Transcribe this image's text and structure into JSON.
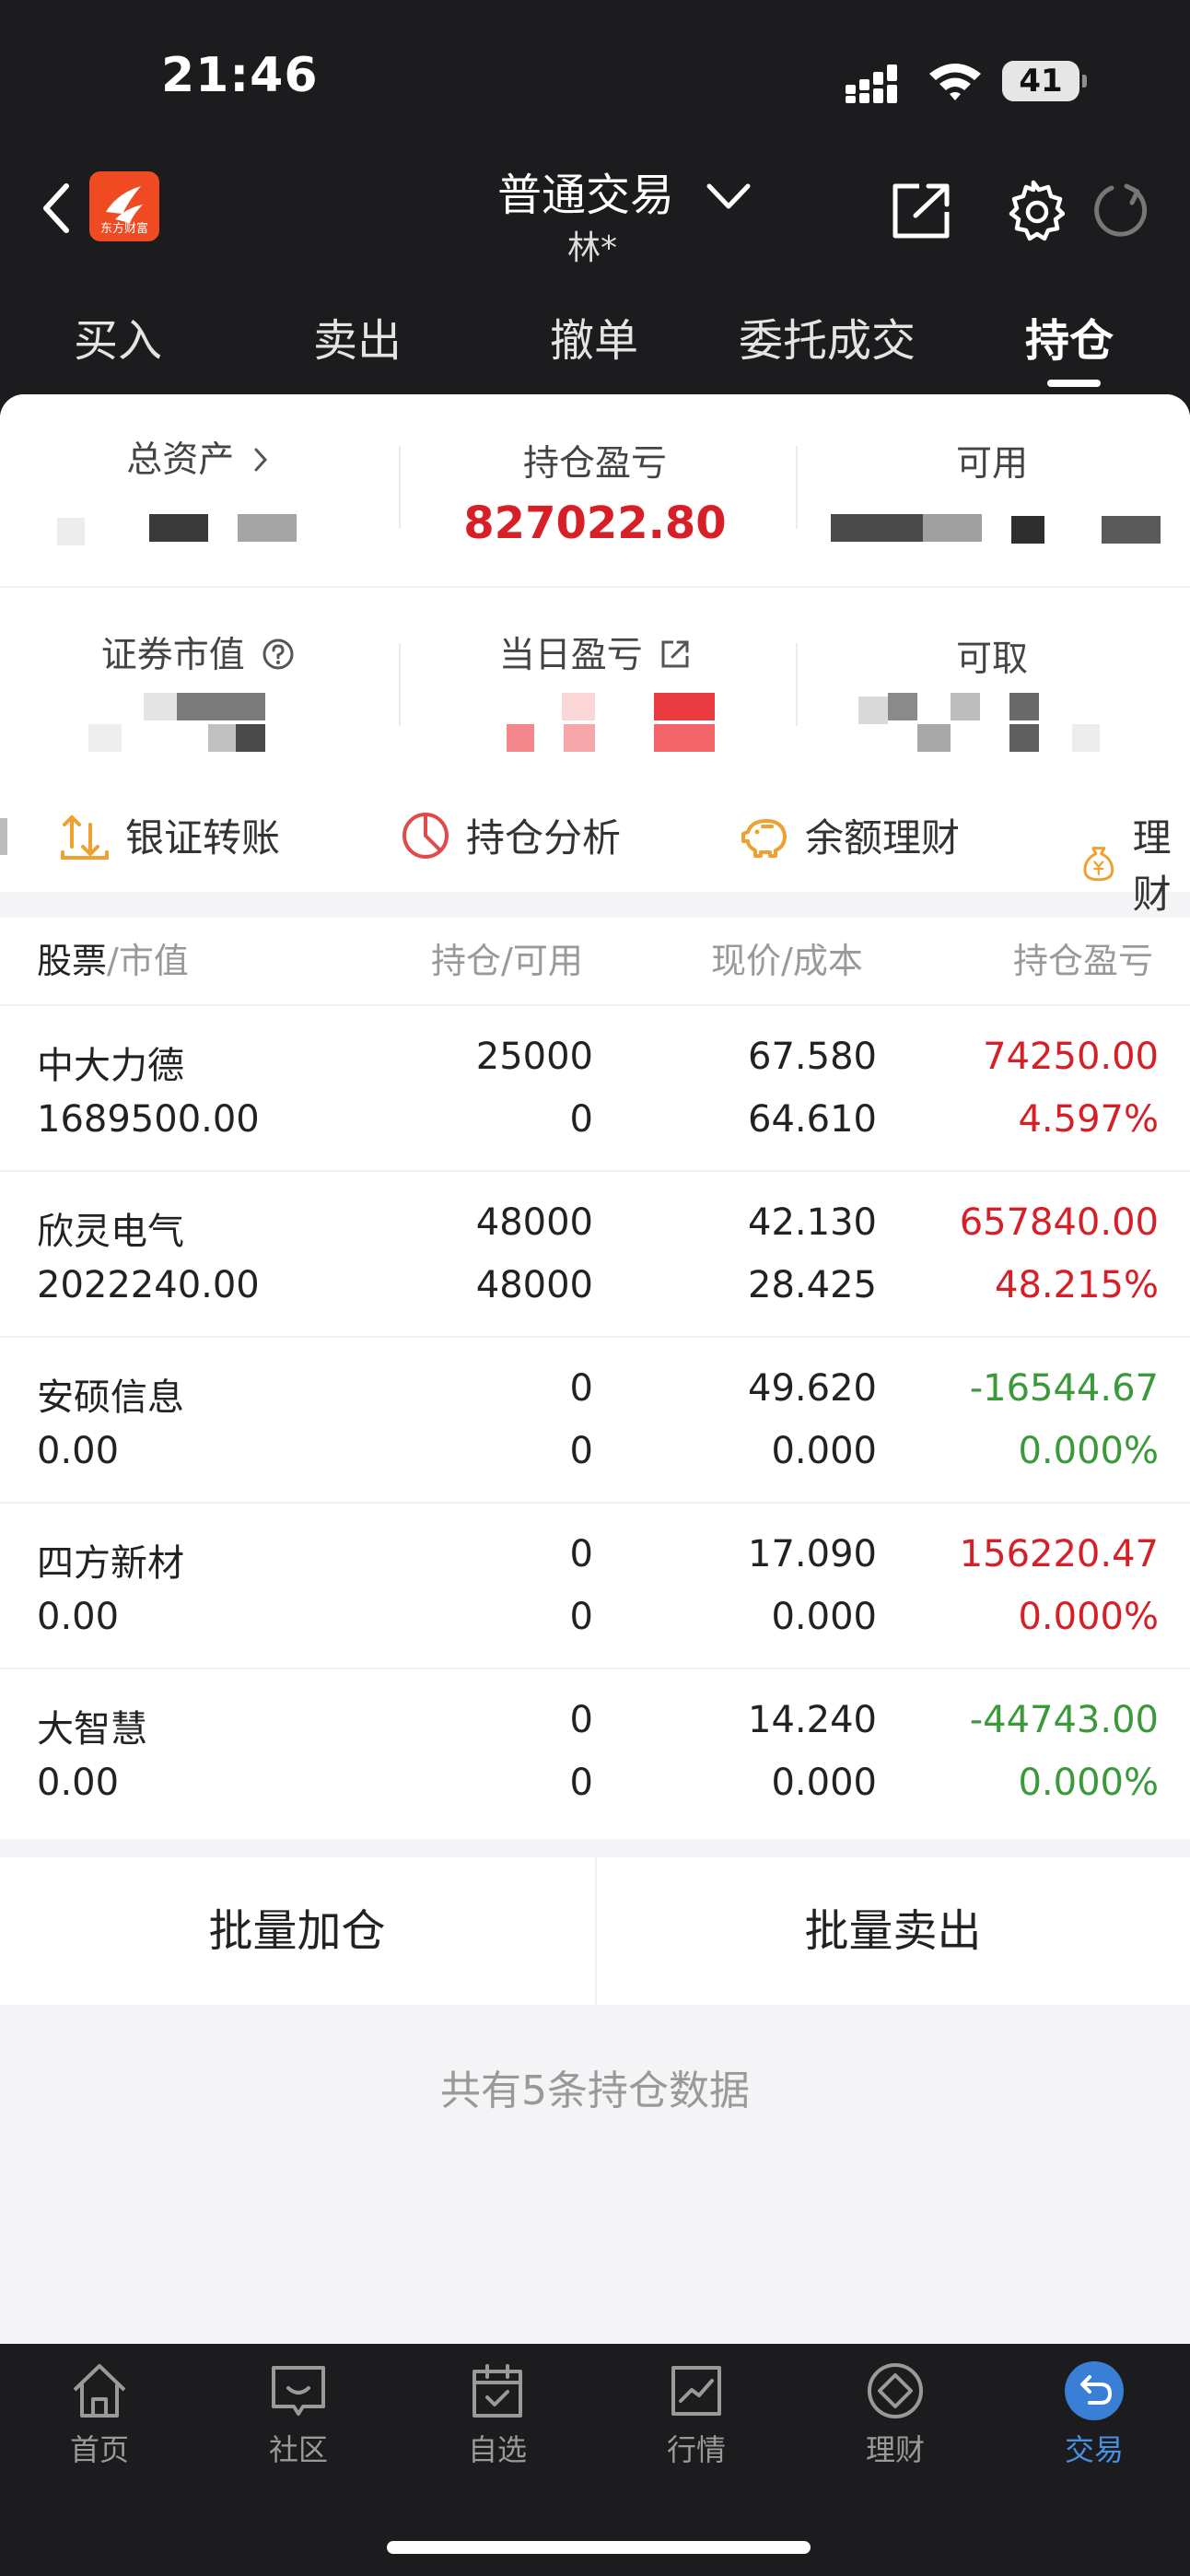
{
  "status": {
    "time": "21:46",
    "battery": "41"
  },
  "header": {
    "logo_text": "东方财富",
    "title": "普通交易",
    "account": "林*"
  },
  "tabs": [
    "买入",
    "卖出",
    "撤单",
    "委托成交",
    "持仓"
  ],
  "summary": {
    "total_assets_label": "总资产",
    "position_pnl_label": "持仓盈亏",
    "position_pnl_value": "827022.80",
    "available_label": "可用",
    "market_value_label": "证券市值",
    "daily_pnl_label": "当日盈亏",
    "withdrawable_label": "可取"
  },
  "quick_links": [
    "银证转账",
    "持仓分析",
    "余额理财",
    "理财"
  ],
  "table": {
    "headers": {
      "stock": "股票",
      "stock_sub": "/市值",
      "position": "持仓",
      "position_sub": "/可用",
      "price": "现价",
      "price_sub": "/成本",
      "pnl": "持仓盈亏"
    },
    "rows": [
      {
        "name": "中大力德",
        "market_value": "1689500.00",
        "position": "25000",
        "available": "0",
        "price": "67.580",
        "cost": "64.610",
        "pnl": "74250.00",
        "pnl_pct": "4.597%",
        "trend": "up"
      },
      {
        "name": "欣灵电气",
        "market_value": "2022240.00",
        "position": "48000",
        "available": "48000",
        "price": "42.130",
        "cost": "28.425",
        "pnl": "657840.00",
        "pnl_pct": "48.215%",
        "trend": "up"
      },
      {
        "name": "安硕信息",
        "market_value": "0.00",
        "position": "0",
        "available": "0",
        "price": "49.620",
        "cost": "0.000",
        "pnl": "-16544.67",
        "pnl_pct": "0.000%",
        "trend": "down"
      },
      {
        "name": "四方新材",
        "market_value": "0.00",
        "position": "0",
        "available": "0",
        "price": "17.090",
        "cost": "0.000",
        "pnl": "156220.47",
        "pnl_pct": "0.000%",
        "trend": "up"
      },
      {
        "name": "大智慧",
        "market_value": "0.00",
        "position": "0",
        "available": "0",
        "price": "14.240",
        "cost": "0.000",
        "pnl": "-44743.00",
        "pnl_pct": "0.000%",
        "trend": "down"
      }
    ]
  },
  "actions": {
    "batch_add": "批量加仓",
    "batch_sell": "批量卖出"
  },
  "footer_note": "共有5条持仓数据",
  "bottom_nav": [
    {
      "label": "首页",
      "icon": "home-icon"
    },
    {
      "label": "社区",
      "icon": "chat-icon"
    },
    {
      "label": "自选",
      "icon": "watchlist-icon"
    },
    {
      "label": "行情",
      "icon": "chart-icon"
    },
    {
      "label": "理财",
      "icon": "diamond-icon"
    },
    {
      "label": "交易",
      "icon": "trade-icon"
    }
  ],
  "colors": {
    "up": "#d61f26",
    "down": "#3a9a3a",
    "accent": "#4a90e2",
    "orange": "#f0a030"
  }
}
